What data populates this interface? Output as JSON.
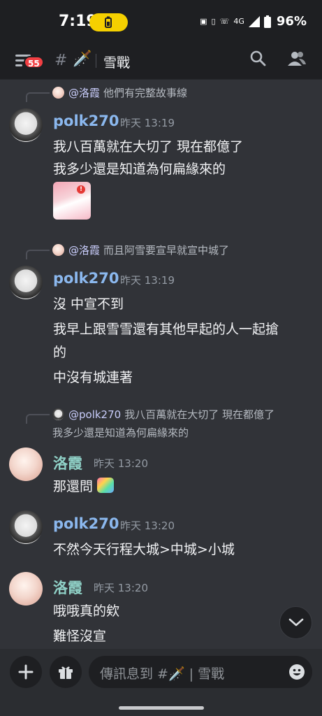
{
  "status": {
    "time": "7:19",
    "battery_pct": "96%",
    "net_label": "4G"
  },
  "header": {
    "unread_badge": "55",
    "hash": "#",
    "channel_emoji": "🗡️",
    "channel_name": "雪戰"
  },
  "messages": [
    {
      "reply_to": "@洛霞",
      "reply_text": "他們有完整故事線",
      "author": "polk270",
      "timestamp": "昨天 13:19",
      "lines": [
        "我八百萬就在大切了 現在都億了",
        "我多少還是知道為何扁緣來的"
      ],
      "sticker_badge": "!"
    },
    {
      "reply_to": "@洛霞",
      "reply_text": "而且阿雪要宣早就宣中城了",
      "author": "polk270",
      "timestamp": "昨天 13:19",
      "lines": [
        "沒 中宣不到",
        "我早上跟雪雪還有其他早起的人一起搶",
        "的",
        "中沒有城連著"
      ]
    },
    {
      "reply_to": "@polk270",
      "reply_text": "我八百萬就在大切了 現在都億了",
      "reply_text_2": "我多少還是知道為何扁緣來的",
      "author": "洛霞",
      "timestamp": "昨天 13:20",
      "lines": [
        "那還問"
      ]
    },
    {
      "author": "polk270",
      "timestamp": "昨天 13:20",
      "lines": [
        "不然今天行程大城>中城>小城"
      ]
    },
    {
      "author": "洛霞",
      "timestamp": "昨天 13:20",
      "lines": [
        "哦哦真的欸",
        "難怪沒宣"
      ]
    }
  ],
  "composer": {
    "placeholder": "傳訊息到 #🗡️ | 雪戰"
  },
  "colors": {
    "background": "#313338",
    "bar": "#1e1f22",
    "polk_name": "#8bb8ee",
    "luo_name": "#8fd0c6",
    "badge": "#f23f43",
    "battery_pill": "#f5d000"
  }
}
